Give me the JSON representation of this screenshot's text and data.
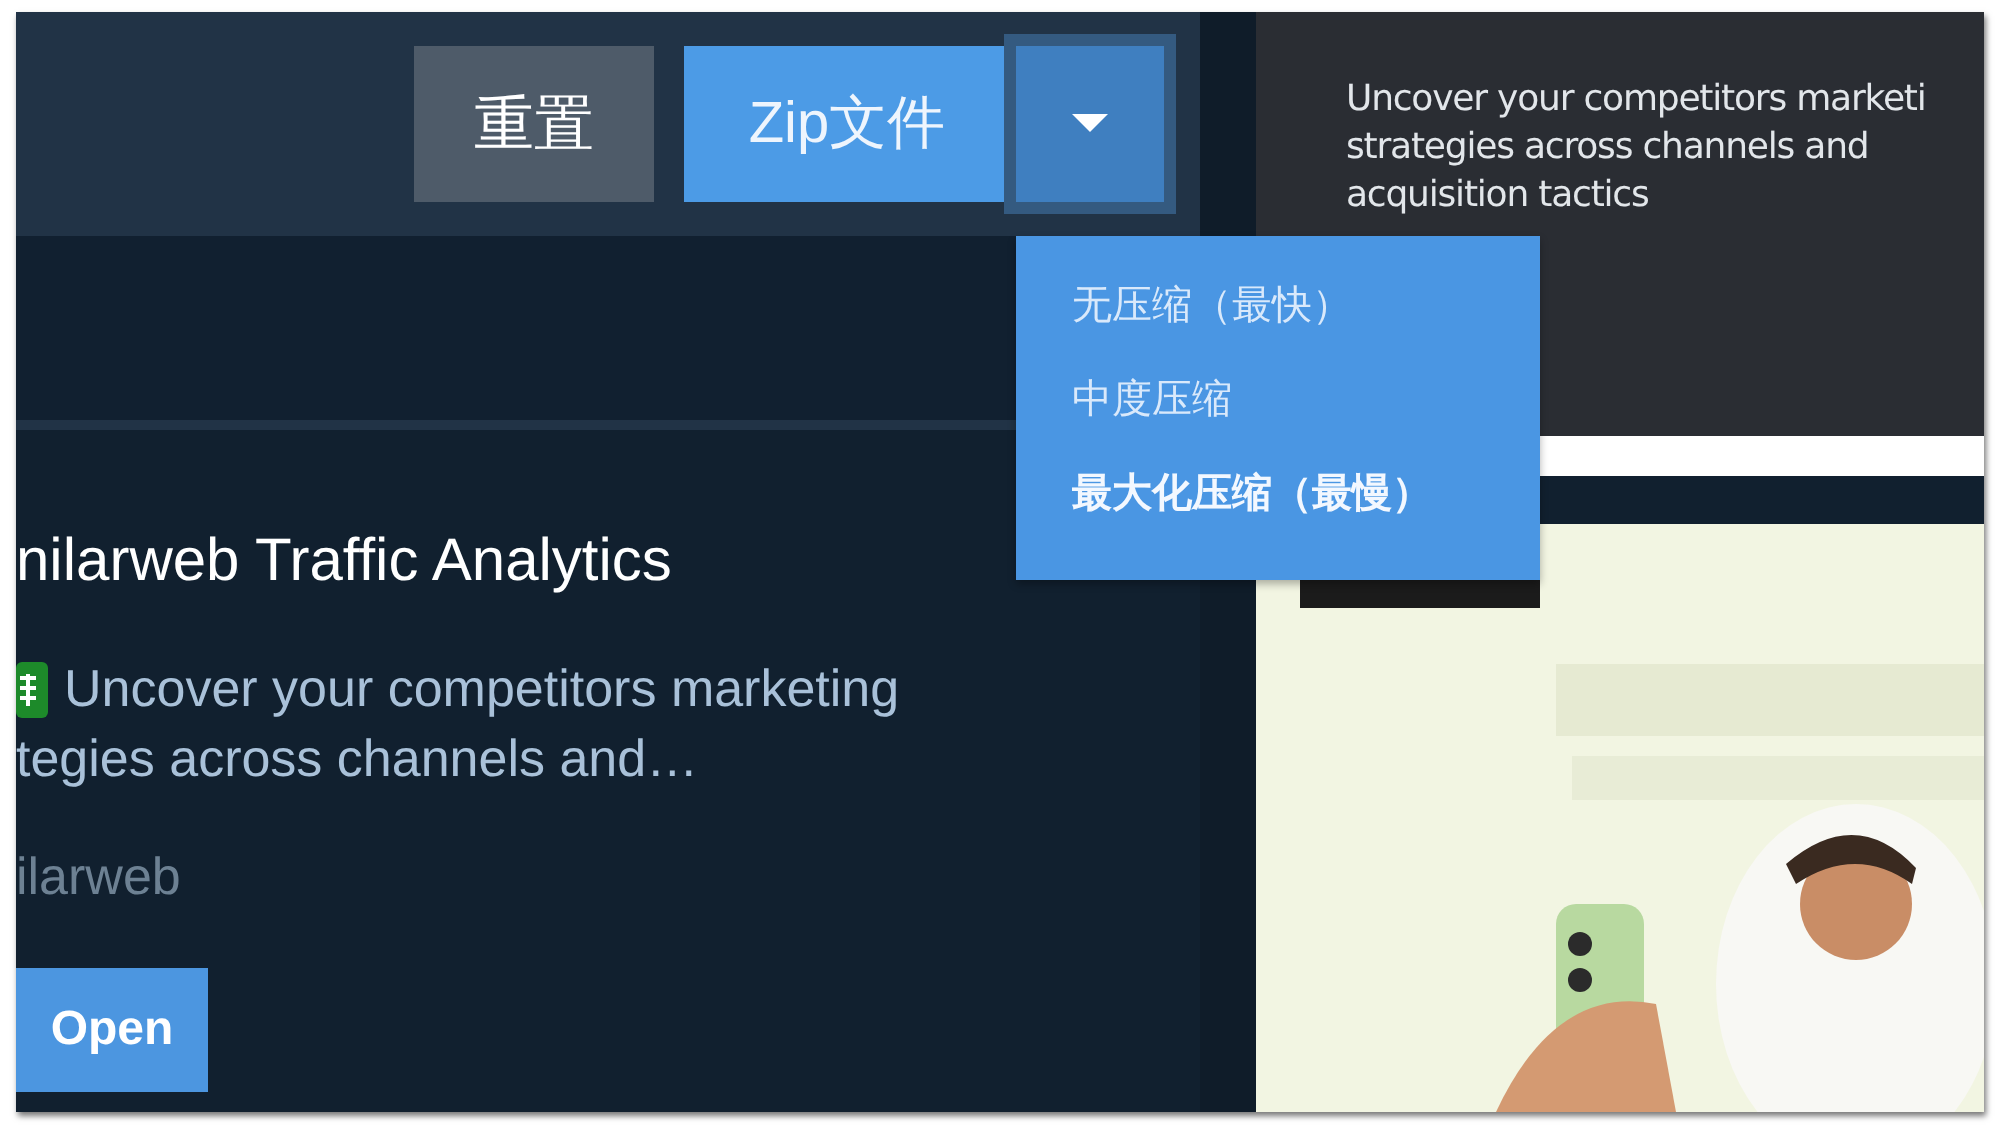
{
  "toolbar": {
    "reset_button": "重置",
    "format_button": "Zip文件"
  },
  "compression_menu": {
    "items": [
      {
        "label": "无压缩（最快）",
        "selected": false
      },
      {
        "label": "中度压缩",
        "selected": false
      },
      {
        "label": "最大化压缩（最慢）",
        "selected": true
      }
    ]
  },
  "result": {
    "title": "nilarweb Traffic Analytics",
    "description_lines": [
      "Uncover your competitors marketing",
      "tegies across channels and…"
    ],
    "source": "ilarweb",
    "open_button": "Open"
  },
  "side_card": {
    "text": "Uncover your competitors marketi\nstrategies across channels and\nacquisition tactics"
  }
}
